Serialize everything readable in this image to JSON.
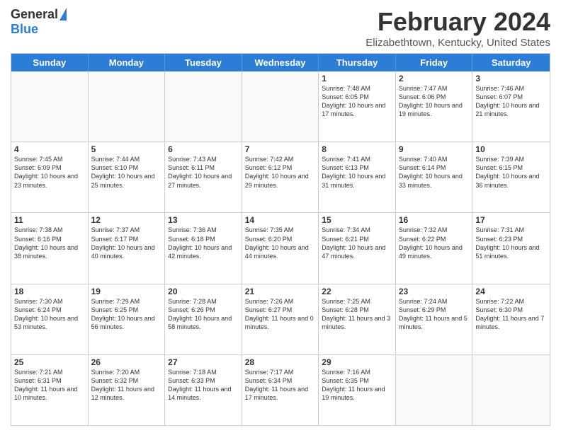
{
  "logo": {
    "general": "General",
    "blue": "Blue"
  },
  "title": "February 2024",
  "subtitle": "Elizabethtown, Kentucky, United States",
  "days": [
    "Sunday",
    "Monday",
    "Tuesday",
    "Wednesday",
    "Thursday",
    "Friday",
    "Saturday"
  ],
  "rows": [
    [
      {
        "day": "",
        "info": ""
      },
      {
        "day": "",
        "info": ""
      },
      {
        "day": "",
        "info": ""
      },
      {
        "day": "",
        "info": ""
      },
      {
        "day": "1",
        "info": "Sunrise: 7:48 AM\nSunset: 6:05 PM\nDaylight: 10 hours and 17 minutes."
      },
      {
        "day": "2",
        "info": "Sunrise: 7:47 AM\nSunset: 6:06 PM\nDaylight: 10 hours and 19 minutes."
      },
      {
        "day": "3",
        "info": "Sunrise: 7:46 AM\nSunset: 6:07 PM\nDaylight: 10 hours and 21 minutes."
      }
    ],
    [
      {
        "day": "4",
        "info": "Sunrise: 7:45 AM\nSunset: 6:09 PM\nDaylight: 10 hours and 23 minutes."
      },
      {
        "day": "5",
        "info": "Sunrise: 7:44 AM\nSunset: 6:10 PM\nDaylight: 10 hours and 25 minutes."
      },
      {
        "day": "6",
        "info": "Sunrise: 7:43 AM\nSunset: 6:11 PM\nDaylight: 10 hours and 27 minutes."
      },
      {
        "day": "7",
        "info": "Sunrise: 7:42 AM\nSunset: 6:12 PM\nDaylight: 10 hours and 29 minutes."
      },
      {
        "day": "8",
        "info": "Sunrise: 7:41 AM\nSunset: 6:13 PM\nDaylight: 10 hours and 31 minutes."
      },
      {
        "day": "9",
        "info": "Sunrise: 7:40 AM\nSunset: 6:14 PM\nDaylight: 10 hours and 33 minutes."
      },
      {
        "day": "10",
        "info": "Sunrise: 7:39 AM\nSunset: 6:15 PM\nDaylight: 10 hours and 36 minutes."
      }
    ],
    [
      {
        "day": "11",
        "info": "Sunrise: 7:38 AM\nSunset: 6:16 PM\nDaylight: 10 hours and 38 minutes."
      },
      {
        "day": "12",
        "info": "Sunrise: 7:37 AM\nSunset: 6:17 PM\nDaylight: 10 hours and 40 minutes."
      },
      {
        "day": "13",
        "info": "Sunrise: 7:36 AM\nSunset: 6:18 PM\nDaylight: 10 hours and 42 minutes."
      },
      {
        "day": "14",
        "info": "Sunrise: 7:35 AM\nSunset: 6:20 PM\nDaylight: 10 hours and 44 minutes."
      },
      {
        "day": "15",
        "info": "Sunrise: 7:34 AM\nSunset: 6:21 PM\nDaylight: 10 hours and 47 minutes."
      },
      {
        "day": "16",
        "info": "Sunrise: 7:32 AM\nSunset: 6:22 PM\nDaylight: 10 hours and 49 minutes."
      },
      {
        "day": "17",
        "info": "Sunrise: 7:31 AM\nSunset: 6:23 PM\nDaylight: 10 hours and 51 minutes."
      }
    ],
    [
      {
        "day": "18",
        "info": "Sunrise: 7:30 AM\nSunset: 6:24 PM\nDaylight: 10 hours and 53 minutes."
      },
      {
        "day": "19",
        "info": "Sunrise: 7:29 AM\nSunset: 6:25 PM\nDaylight: 10 hours and 56 minutes."
      },
      {
        "day": "20",
        "info": "Sunrise: 7:28 AM\nSunset: 6:26 PM\nDaylight: 10 hours and 58 minutes."
      },
      {
        "day": "21",
        "info": "Sunrise: 7:26 AM\nSunset: 6:27 PM\nDaylight: 11 hours and 0 minutes."
      },
      {
        "day": "22",
        "info": "Sunrise: 7:25 AM\nSunset: 6:28 PM\nDaylight: 11 hours and 3 minutes."
      },
      {
        "day": "23",
        "info": "Sunrise: 7:24 AM\nSunset: 6:29 PM\nDaylight: 11 hours and 5 minutes."
      },
      {
        "day": "24",
        "info": "Sunrise: 7:22 AM\nSunset: 6:30 PM\nDaylight: 11 hours and 7 minutes."
      }
    ],
    [
      {
        "day": "25",
        "info": "Sunrise: 7:21 AM\nSunset: 6:31 PM\nDaylight: 11 hours and 10 minutes."
      },
      {
        "day": "26",
        "info": "Sunrise: 7:20 AM\nSunset: 6:32 PM\nDaylight: 11 hours and 12 minutes."
      },
      {
        "day": "27",
        "info": "Sunrise: 7:18 AM\nSunset: 6:33 PM\nDaylight: 11 hours and 14 minutes."
      },
      {
        "day": "28",
        "info": "Sunrise: 7:17 AM\nSunset: 6:34 PM\nDaylight: 11 hours and 17 minutes."
      },
      {
        "day": "29",
        "info": "Sunrise: 7:16 AM\nSunset: 6:35 PM\nDaylight: 11 hours and 19 minutes."
      },
      {
        "day": "",
        "info": ""
      },
      {
        "day": "",
        "info": ""
      }
    ]
  ]
}
